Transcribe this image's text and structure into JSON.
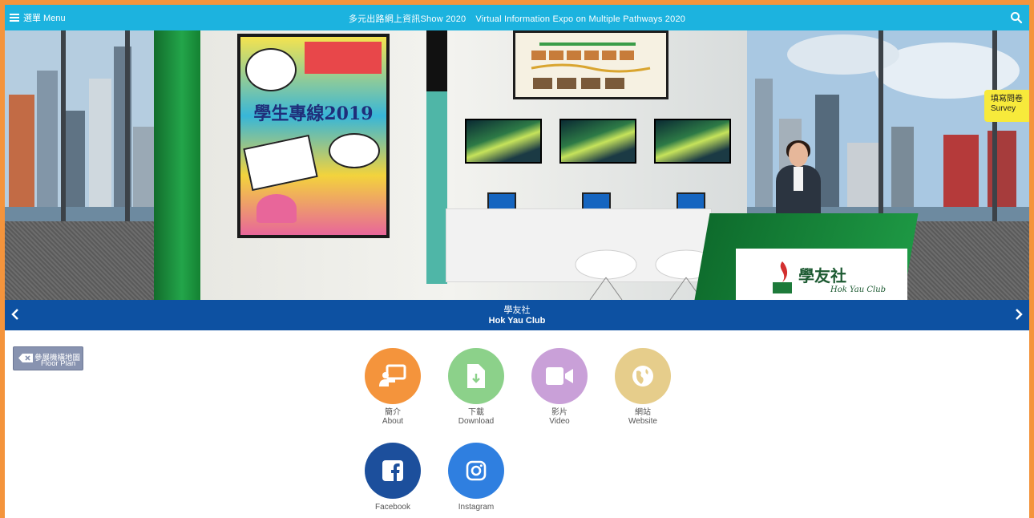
{
  "topbar": {
    "menu_label": "選單 Menu",
    "title_zh": "多元出路網上資訊Show 2020",
    "title_en": "Virtual Information Expo on Multiple Pathways 2020",
    "bg_color": "#1cb3df"
  },
  "scene": {
    "poster_text": "學生專線2019",
    "counter_logo_zh": "學友社",
    "counter_logo_en": "Hok Yau Club"
  },
  "survey": {
    "label_zh": "填寫問卷",
    "label_en": "Survey"
  },
  "booth_nav": {
    "name_zh": "學友社",
    "name_en": "Hok Yau Club",
    "bg_color": "#0d51a2"
  },
  "floor_plan": {
    "label_zh": "參展機構地圖",
    "label_en": "Floor Plan"
  },
  "actions": [
    {
      "label_zh": "簡介",
      "label_en": "About",
      "color": "#f4943c",
      "icon": "presentation-icon"
    },
    {
      "label_zh": "下載",
      "label_en": "Download",
      "color": "#8cd18a",
      "icon": "download-file-icon"
    },
    {
      "label_zh": "影片",
      "label_en": "Video",
      "color": "#c9a0d8",
      "icon": "video-camera-icon"
    },
    {
      "label_zh": "網站",
      "label_en": "Website",
      "color": "#e6cd8b",
      "icon": "globe-icon"
    }
  ],
  "social": [
    {
      "label": "Facebook",
      "color": "#1c4f9c",
      "icon": "facebook-icon"
    },
    {
      "label": "Instagram",
      "color": "#2f7fe0",
      "icon": "instagram-icon"
    }
  ],
  "page_border_color": "#f4943c"
}
